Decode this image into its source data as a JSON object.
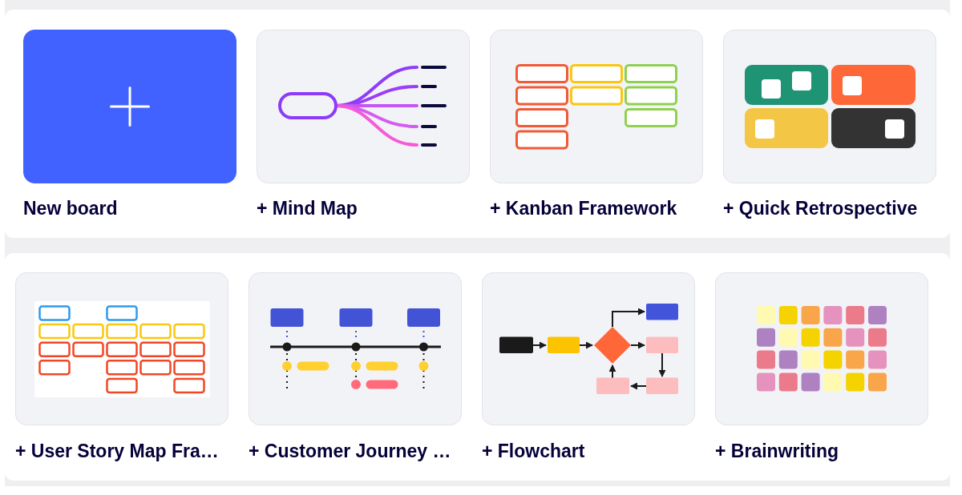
{
  "sections": [
    {
      "boards": [
        {
          "kind": "new_board",
          "label": "New board"
        },
        {
          "kind": "mind_map",
          "label": "+ Mind Map"
        },
        {
          "kind": "kanban",
          "label": "+ Kanban Framework"
        },
        {
          "kind": "retrospective",
          "label": "+ Quick Retrospective"
        }
      ]
    },
    {
      "boards": [
        {
          "kind": "story_map",
          "label": "+ User Story Map Fra…"
        },
        {
          "kind": "journey_map",
          "label": "+ Customer Journey …"
        },
        {
          "kind": "flowchart",
          "label": "+ Flowchart"
        },
        {
          "kind": "brainwriting",
          "label": "+ Brainwriting"
        }
      ]
    }
  ]
}
